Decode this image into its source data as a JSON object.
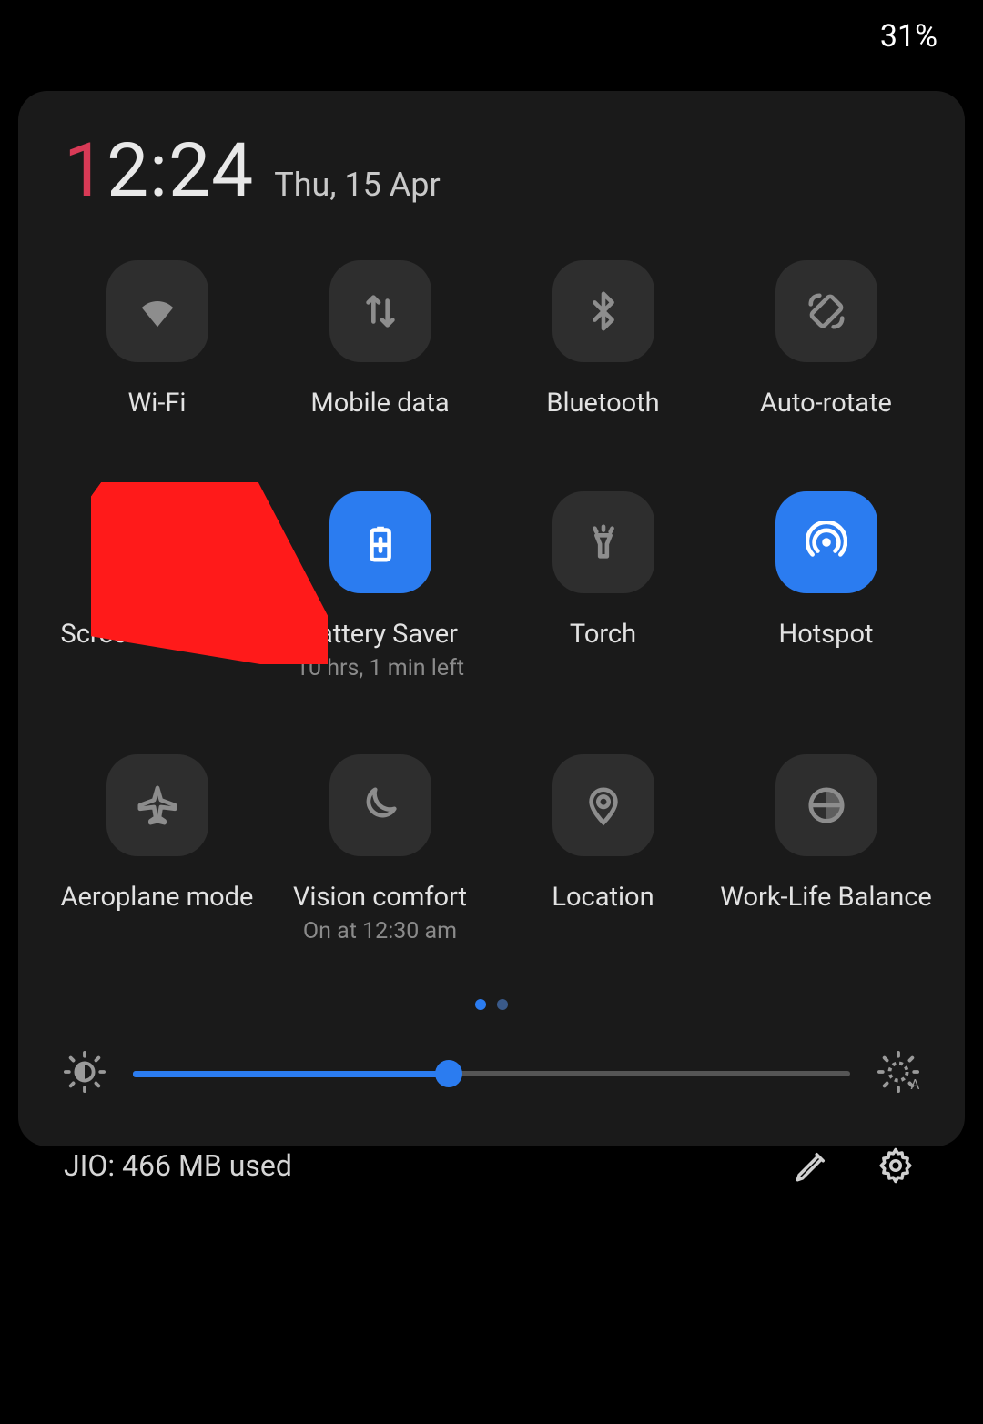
{
  "status": {
    "battery": "31%"
  },
  "clock": {
    "hour_accent": "1",
    "rest": "2:24",
    "date": "Thu, 15 Apr"
  },
  "tiles": [
    {
      "label": "Wi-Fi",
      "sub": ""
    },
    {
      "label": "Mobile data",
      "sub": ""
    },
    {
      "label": "Bluetooth",
      "sub": ""
    },
    {
      "label": "Auto-rotate",
      "sub": ""
    },
    {
      "label": "Screen Recorder",
      "sub": ""
    },
    {
      "label": "Battery Saver",
      "sub": "10 hrs, 1 min left"
    },
    {
      "label": "Torch",
      "sub": ""
    },
    {
      "label": "Hotspot",
      "sub": ""
    },
    {
      "label": "Aeroplane mode",
      "sub": ""
    },
    {
      "label": "Vision comfort",
      "sub": "On at 12:30 am"
    },
    {
      "label": "Location",
      "sub": ""
    },
    {
      "label": "Work-Life Balance",
      "sub": ""
    }
  ],
  "brightness": {
    "percent": 44
  },
  "footer": {
    "usage": "JIO: 466 MB used"
  },
  "colors": {
    "accent": "#2b7cf0",
    "clock_accent": "#d83a56"
  }
}
